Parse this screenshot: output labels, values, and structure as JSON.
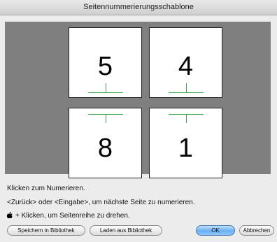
{
  "window": {
    "title": "Seitennummerierungsschablone"
  },
  "pages": [
    {
      "number": "5"
    },
    {
      "number": "4"
    },
    {
      "number": "8"
    },
    {
      "number": "1"
    }
  ],
  "instructions": {
    "line1": "Klicken zum Numerieren.",
    "line2": "<Zurück> oder <Eingabe>, um nächste Seite zu numerieren.",
    "line3": "+ Klicken, um Seitenreihe zu drehen."
  },
  "buttons": {
    "save_library": "Speichern in Bibliothek",
    "load_library": "Laden aus Bibliothek",
    "ok": "OK",
    "cancel": "Abbrechen"
  },
  "icons": {
    "modifier": "apple-icon"
  },
  "colors": {
    "canvas": "#7f7f7f",
    "fold_marks": "#3fa34d",
    "default_button": "#6ab0f3"
  }
}
